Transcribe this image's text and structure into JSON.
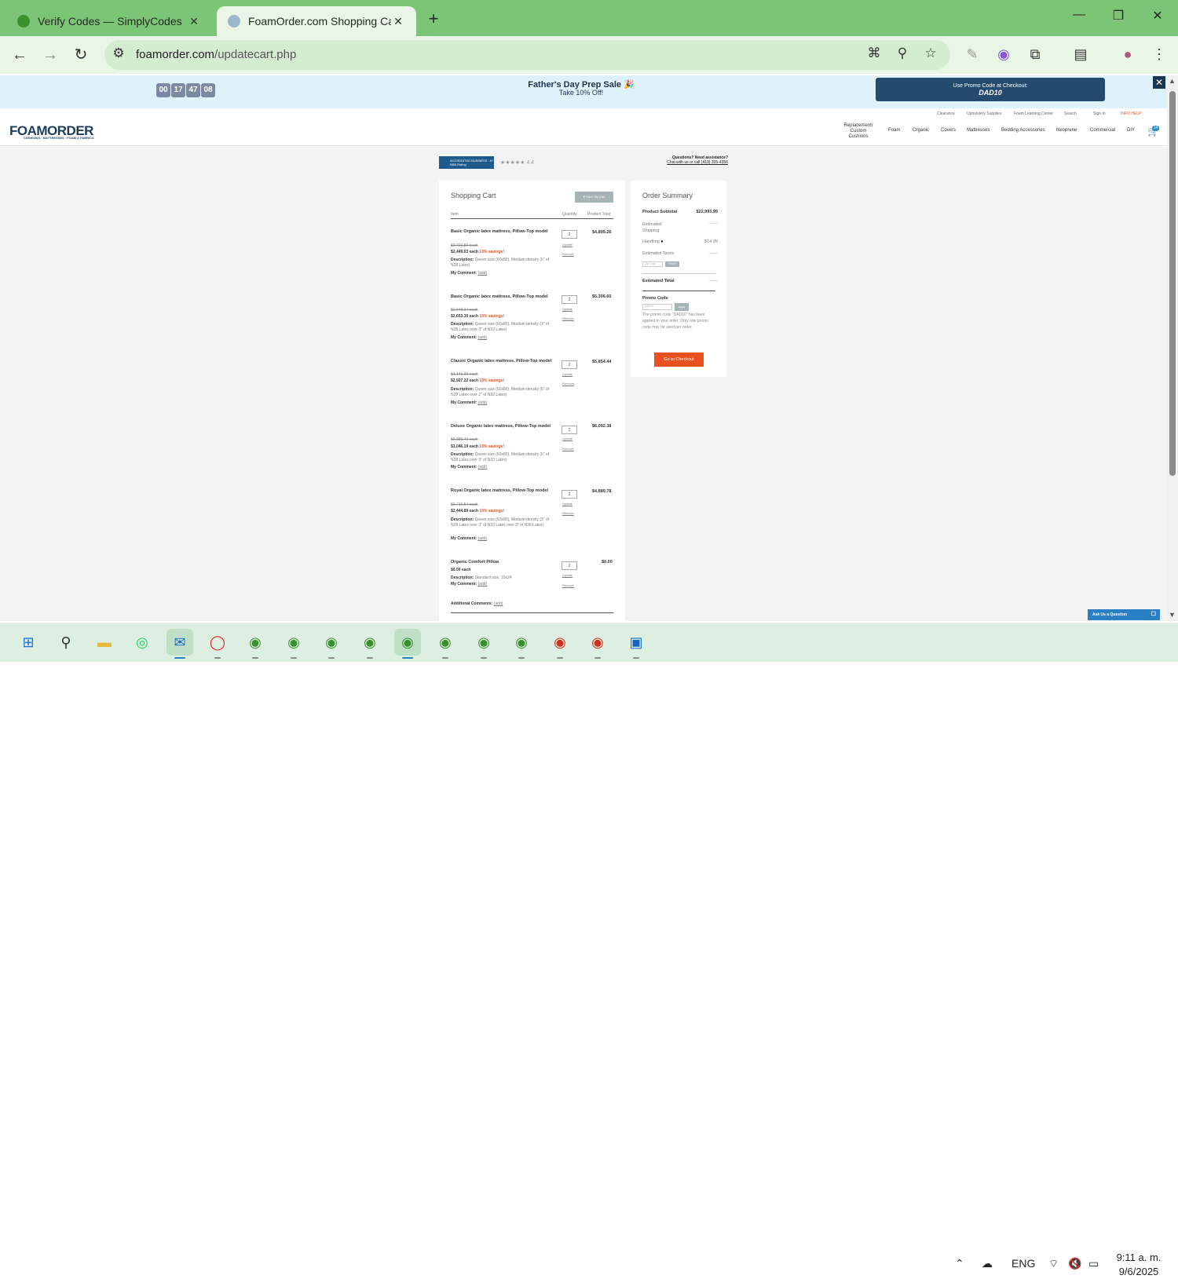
{
  "browser": {
    "tabs": [
      {
        "title": "Verify Codes — SimplyCodes",
        "favicon_color": "#3a8f2e"
      },
      {
        "title": "FoamOrder.com Shopping Cart",
        "favicon_color": "#9db7c8"
      }
    ],
    "url_domain": "foamorder.com",
    "url_path": "/updatecart.php"
  },
  "promo_bar": {
    "countdown": [
      "00",
      "17",
      "47",
      "08"
    ],
    "title": "Father's Day Prep Sale 🎉",
    "subtitle": "Take 10% Off!",
    "button_line1": "Use Promo Code at Checkout:",
    "button_code": "DAD10"
  },
  "utility_links": [
    "Clearance",
    "Upholstery Supplies",
    "Foam Learning Center",
    "Search",
    "Sign In",
    "INFO HELP"
  ],
  "site": {
    "logo": "FOAMORDER",
    "logo_sub": "CUSHIONS · MATTRESSES · FOAM & FABRICS",
    "nav": [
      "Replacement/ Custom Cushions",
      "Foam",
      "Organic",
      "Covers",
      "Mattresses",
      "Bedding Accessories",
      "Neoprene",
      "Commercial",
      "DIY"
    ],
    "cart_count": "14",
    "bbb_text": "ACCREDITED BUSINESS · A+ BBB Rating",
    "rating": "★★★★★ 4.4",
    "help_line1": "Questions? Need assistance?",
    "help_line2": "Chat with us or call (413) 305-4356"
  },
  "cart": {
    "heading": "Shopping Cart",
    "save_label": "♥ Save My Cart",
    "col_item": "Item",
    "col_qty": "Quantity",
    "col_total": "Product Total",
    "update_label": "Update",
    "remove_label": "Remove",
    "comment_label": "My Comment:",
    "comment_link": "(add)",
    "desc_label": "Description:",
    "items": [
      {
        "title": "Basic Organic latex mattress, Pillow-Top model",
        "orig": "$2,721.81 each",
        "price": "$2,449.63 each",
        "saving": "10% savings!",
        "desc": "Queen size (60x80), Medium density (6\" of N28 Latex)",
        "qty": "2",
        "total": "$4,899.26"
      },
      {
        "title": "Basic Organic latex mattress, Pillow-Top model",
        "orig": "$2,948.34 each",
        "price": "$2,653.30 each",
        "saving": "10% savings!",
        "desc": "Queen size (60x80), Medium density (3\" of N28 Latex over 3\" of N32 Latex)",
        "qty": "2",
        "total": "$5,306.60"
      },
      {
        "title": "Classic Organic latex mattress, Pillow-Top model",
        "orig": "$3,141.36 each",
        "price": "$2,927.22 each",
        "saving": "10% savings!",
        "desc": "Queen size (60x80), Medium density (6\" of N28 Latex over 2\" of N32 Latex)",
        "qty": "2",
        "total": "$5,854.44"
      },
      {
        "title": "Deluxe Organic latex mattress, Pillow-Top model",
        "orig": "$3,385.40 each",
        "price": "$3,046.19 each",
        "saving": "10% savings!",
        "desc": "Queen size (60x80), Medium density (6\" of N28 Latex over 3\" of N32 Latex)",
        "qty": "2",
        "total": "$6,092.38"
      },
      {
        "title": "Royal Organic latex mattress, Pillow-Top model",
        "orig": "$2,716.54 each",
        "price": "$2,444.89 each",
        "saving": "10% savings!",
        "desc": "Queen size (60x80), Medium density (3\" of N28 Latex over 3\" of N32 Latex over 3\" of N36 Latex)",
        "qty": "2",
        "total": "$4,889.78"
      },
      {
        "title": "Organic Comfort Pillow",
        "orig": "",
        "price": "$0.00 each",
        "saving": "",
        "desc": "Standard size, 19x24",
        "qty": "2",
        "total": "$0.00"
      }
    ],
    "additional_label": "Additional Comments:",
    "additional_link": "(add)"
  },
  "summary": {
    "heading": "Order Summary",
    "subtotal_label": "Product Subtotal",
    "subtotal": "$22,993.99",
    "shipping_label": "Estimated Shipping",
    "shipping": "——",
    "handling_label": "Handling",
    "handling": "$14.99",
    "taxes_label": "Estimated Taxes",
    "taxes": "——",
    "zip_placeholder": "Zip Code",
    "zip_btn": "Reset",
    "total_label": "Estimated Total",
    "total": "——",
    "promo_label": "Promo Code",
    "promo_value": "DAD10",
    "promo_apply": "Apply",
    "promo_note": "The promo code \"DAD10\" has been applied to your order. Only one promo code may be used per order.",
    "checkout": "Go to Checkout"
  },
  "ask_question": "Ask Us a Question",
  "taskbar": {
    "lang": "ENG",
    "time": "9:11 a. m.",
    "date": "9/6/2025"
  }
}
